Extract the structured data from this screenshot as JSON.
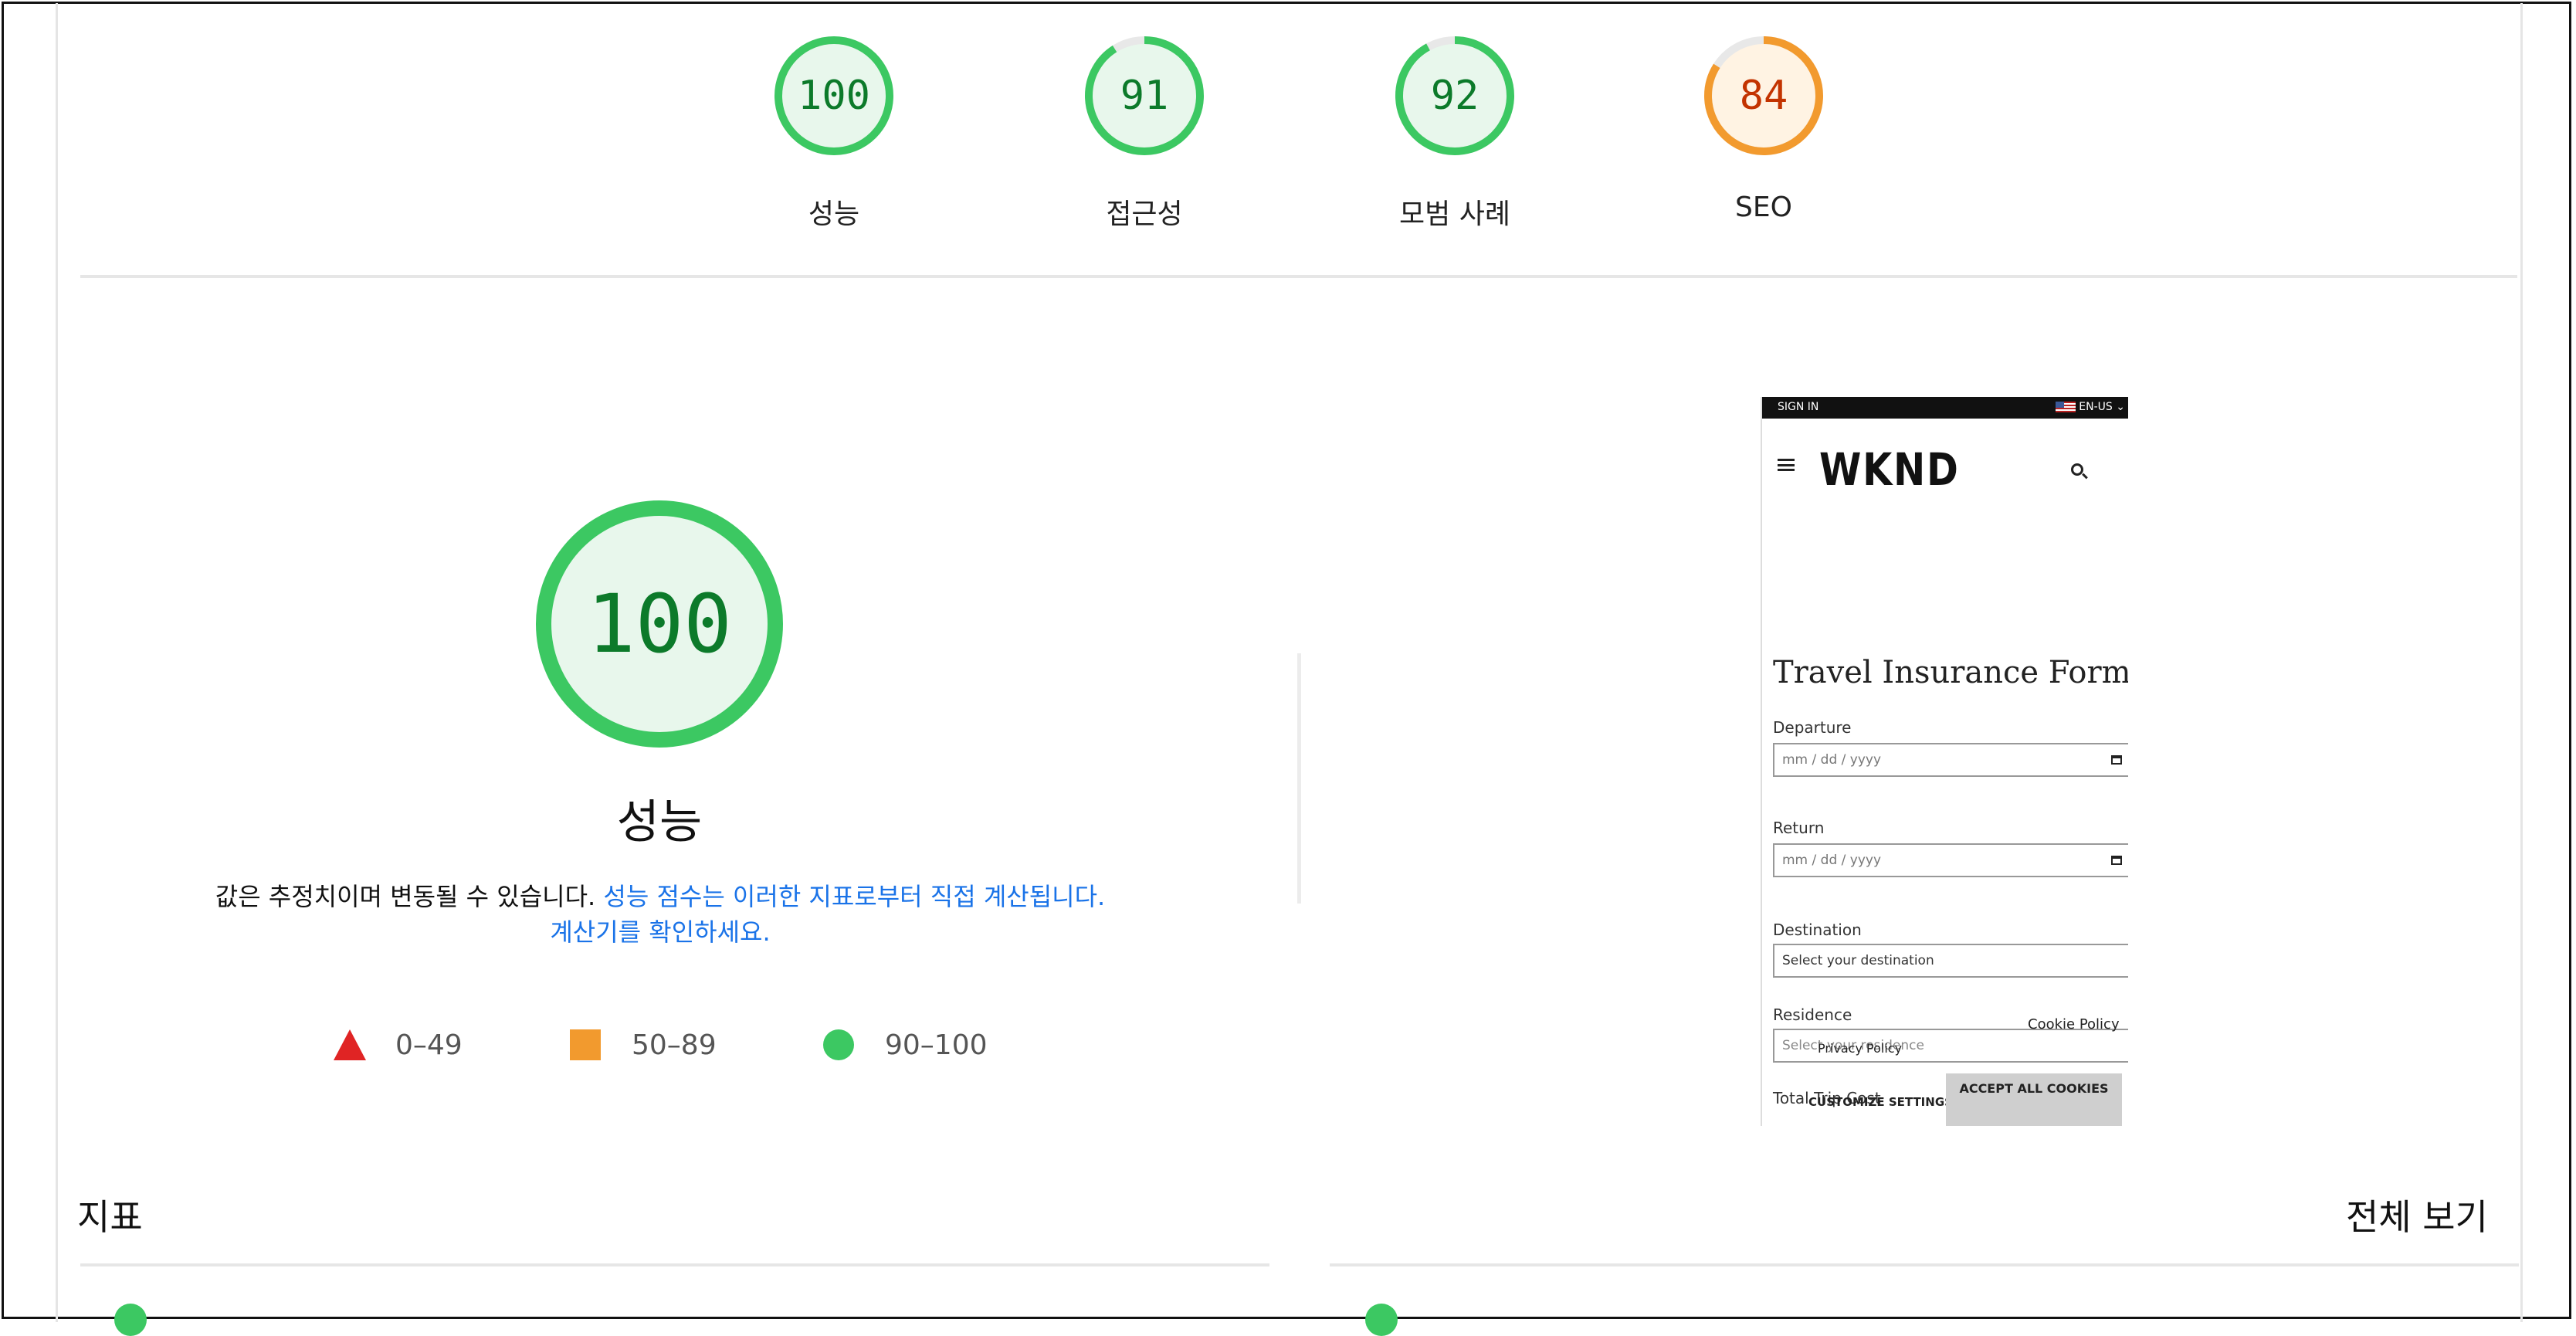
{
  "scores": [
    {
      "value": "100",
      "label": "성능",
      "percent": 100,
      "rating": "good"
    },
    {
      "value": "91",
      "label": "접근성",
      "percent": 91,
      "rating": "good"
    },
    {
      "value": "92",
      "label": "모범 사례",
      "percent": 92,
      "rating": "good"
    },
    {
      "value": "84",
      "label": "SEO",
      "percent": 84,
      "rating": "average"
    }
  ],
  "colors": {
    "good_ring": "#3cc862",
    "good_fill": "#e8f7ec",
    "good_text": "#0c7a2a",
    "avg_ring": "#f29a2e",
    "avg_fill": "#fff3e3",
    "avg_text": "#c33300",
    "poor": "#e02424",
    "link": "#1a73e8"
  },
  "performance": {
    "score": "100",
    "percent": 100,
    "title": "성능",
    "desc_plain": "값은 추정치이며 변동될 수 있습니다. ",
    "desc_link1": "성능 점수는 이러한 지표로부터 직접 계산됩니다.",
    "desc_link2": "계산기를 확인하세요."
  },
  "legend": [
    {
      "shape": "triangle",
      "range": "0–49"
    },
    {
      "shape": "square",
      "range": "50–89"
    },
    {
      "shape": "circle",
      "range": "90–100"
    }
  ],
  "metrics": {
    "title": "지표",
    "view_all": "전체 보기"
  },
  "screenshot": {
    "signin": "SIGN IN",
    "lang": "EN-US",
    "logo": "WKND",
    "form_title": "Travel Insurance Form",
    "departure_label": "Departure",
    "departure_placeholder": "mm / dd / yyyy",
    "return_label": "Return",
    "return_placeholder": "mm / dd / yyyy",
    "destination_label": "Destination",
    "destination_placeholder": "Select your destination",
    "residence_label": "Residence",
    "residence_placeholder": "Select your residence",
    "total_label": "Total Trip Cost",
    "cookie_policy": "Cookie Policy",
    "privacy_policy": "Privacy Policy",
    "customize": "CUSTOMIZE SETTINGS",
    "accept": "ACCEPT ALL COOKIES"
  }
}
